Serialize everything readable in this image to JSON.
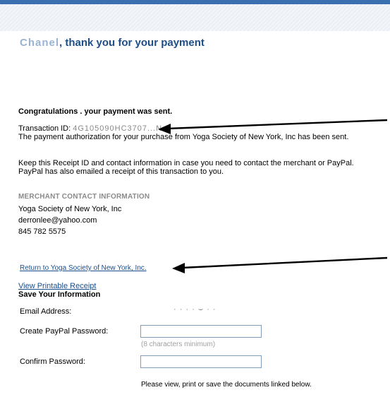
{
  "header": {
    "name_masked": "Chanel",
    "title": ", thank you for your payment"
  },
  "confirmation": {
    "title": "Congratulations . your payment was sent.",
    "transaction_label": "Transaction ID:",
    "transaction_id_masked": "4G105090HC3707...N",
    "authorization_text": "The payment authorization for your purchase from Yoga Society of New York, Inc has been sent.",
    "keep_line_1": "Keep this Receipt ID and contact information in case you need to contact the merchant or PayPal.",
    "keep_line_2": "PayPal has also emailed a receipt of this transaction to you."
  },
  "merchant": {
    "heading": "MERCHANT CONTACT INFORMATION",
    "name": "Yoga Society of New York, Inc",
    "email": "derronlee@yahoo.com",
    "phone": "845 782 5575"
  },
  "links": {
    "return_link": "Return to Yoga Society of New York, Inc.",
    "printable_receipt": "View Printable Receipt"
  },
  "save_info": {
    "heading": "Save Your Information",
    "email_label": "Email Address:",
    "email_value_masked": "· · ·  ·  ⌣ · ·",
    "password_label": "Create PayPal Password:",
    "password_hint": "(8 characters minimum)",
    "confirm_label": "Confirm Password:",
    "documents_note": "Please view, print or save the documents linked below."
  },
  "colors": {
    "accent": "#1c4e8a",
    "top_bar": "#3a6fb0",
    "muted": "#8a8a8a"
  }
}
